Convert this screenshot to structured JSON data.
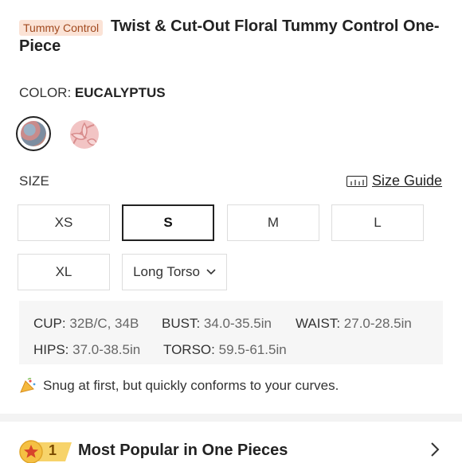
{
  "product": {
    "badge": "Tummy Control",
    "title": "Twist & Cut-Out Floral Tummy Control One-Piece"
  },
  "color": {
    "label": "COLOR:",
    "selected": "EUCALYPTUS",
    "swatches": [
      "eucalyptus-swatch",
      "pink-floral-swatch"
    ]
  },
  "size": {
    "label": "SIZE",
    "guide_label": "Size Guide",
    "options": [
      "XS",
      "S",
      "M",
      "L",
      "XL"
    ],
    "selected": "S",
    "torso_select": "Long Torso"
  },
  "measurements": {
    "cup_label": "CUP:",
    "cup": "32B/C, 34B",
    "bust_label": "BUST:",
    "bust": "34.0-35.5in",
    "waist_label": "WAIST:",
    "waist": "27.0-28.5in",
    "hips_label": "HIPS:",
    "hips": "37.0-38.5in",
    "torso_label": "TORSO:",
    "torso": "59.5-61.5in"
  },
  "fit_note": "Snug at first, but quickly conforms to your curves.",
  "popular": {
    "rank": "1",
    "text": "Most Popular in One Pieces"
  },
  "colors": {
    "badge_bg": "#fbe3d6",
    "badge_text": "#a14a1f",
    "rank_gold": "#f5c043"
  }
}
